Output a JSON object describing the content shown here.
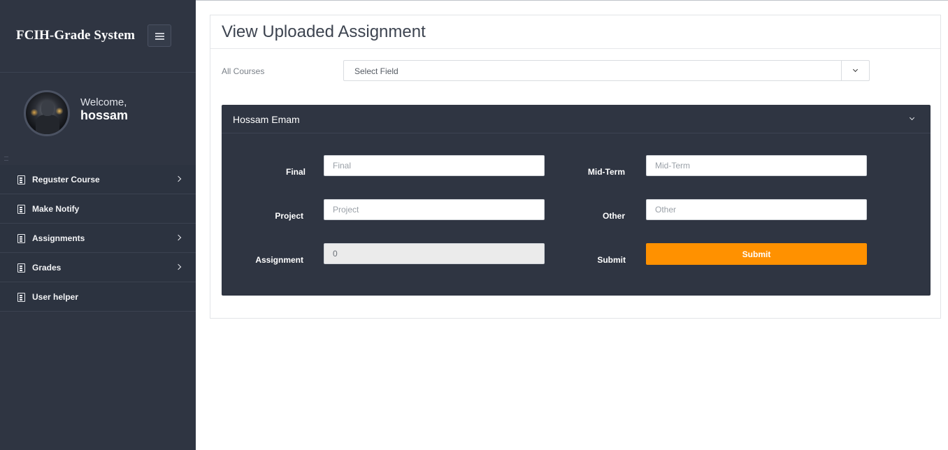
{
  "sidebar": {
    "brand": "FCIH-Grade System",
    "welcome_text": "Welcome,",
    "username": "hossam",
    "items": [
      {
        "label": "Reguster Course",
        "has_submenu": true
      },
      {
        "label": "Make Notify",
        "has_submenu": false
      },
      {
        "label": "Assignments",
        "has_submenu": true
      },
      {
        "label": "Grades",
        "has_submenu": true
      },
      {
        "label": "User helper",
        "has_submenu": false
      }
    ]
  },
  "main": {
    "title": "View Uploaded Assignment",
    "filter": {
      "label": "All Courses",
      "select_value": "Select Field"
    },
    "student_card": {
      "name": "Hossam Emam",
      "fields": {
        "final": {
          "label": "Final",
          "placeholder": "Final",
          "value": ""
        },
        "midterm": {
          "label": "Mid-Term",
          "placeholder": "Mid-Term",
          "value": ""
        },
        "project": {
          "label": "Project",
          "placeholder": "Project",
          "value": ""
        },
        "other": {
          "label": "Other",
          "placeholder": "Other",
          "value": ""
        },
        "assignment": {
          "label": "Assignment",
          "value": "0"
        },
        "submit": {
          "label": "Submit",
          "button_label": "Submit"
        }
      }
    }
  },
  "colors": {
    "sidebar_bg": "#2f3542",
    "card_bg": "#2f3542",
    "submit_accent": "#ff9100"
  }
}
